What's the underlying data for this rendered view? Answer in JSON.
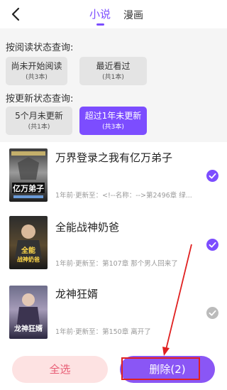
{
  "header": {
    "back_icon": "chevron-left-icon",
    "tabs": [
      {
        "label": "小说",
        "active": true
      },
      {
        "label": "漫画",
        "active": false
      }
    ],
    "accent": "#7c4dff"
  },
  "filters": {
    "read_status": {
      "title": "按阅读状态查询:",
      "options": [
        {
          "label": "尚未开始阅读",
          "count": "(共3本)"
        },
        {
          "label": "最近看过",
          "count": "(共1本)"
        }
      ]
    },
    "update_status": {
      "title": "按更新状态查询:",
      "options": [
        {
          "label": "5个月未更新",
          "count": "(共1本)",
          "active": false
        },
        {
          "label": "超过1年未更新",
          "count": "(共3本)",
          "active": true
        }
      ]
    }
  },
  "books": [
    {
      "title": "万界登录之我有亿万弟子",
      "meta": "1年前·更新至：<!--名称：-->第2496章 绿...",
      "checked": true,
      "cover_text": "亿万弟子"
    },
    {
      "title": "全能战神奶爸",
      "meta": "1年前·更新至：第107章 那个男人回来了",
      "checked": true,
      "cover_text": "全能战神奶爸"
    },
    {
      "title": "龙神狂婿",
      "meta": "1年前·更新至：第150章 离开了",
      "checked": false,
      "cover_text": "龙神狂婿"
    }
  ],
  "bottom_bar": {
    "select_all_label": "全选",
    "delete_label": "删除(2)"
  },
  "colors": {
    "check_on": "#7c4dff",
    "check_off": "#bbbbbb",
    "annotation": "#e02020"
  }
}
